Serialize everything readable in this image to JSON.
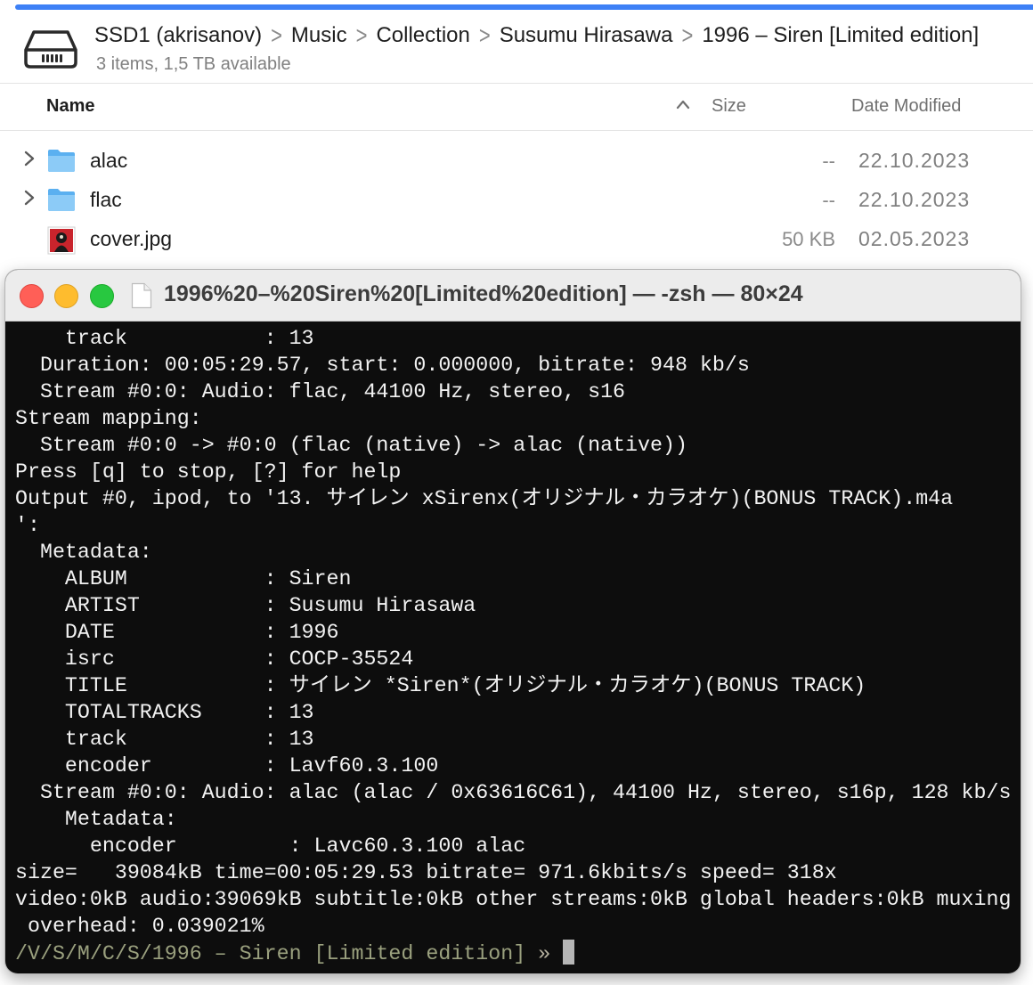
{
  "finder": {
    "accent_color": "#3d80f6",
    "drive_icon": "external-drive-icon",
    "breadcrumb": [
      "SSD1 (akrisanov)",
      "Music",
      "Collection",
      "Susumu Hirasawa",
      "1996 – Siren [Limited edition]"
    ],
    "breadcrumb_separator": ">",
    "subtitle": "3 items, 1,5 TB available",
    "columns": {
      "name": "Name",
      "sort_caret": "^",
      "size": "Size",
      "date": "Date Modified"
    },
    "rows": [
      {
        "disclosure": ">",
        "icon": "folder-icon",
        "name": "alac",
        "size": "--",
        "date": "22.10.2023"
      },
      {
        "disclosure": ">",
        "icon": "folder-icon",
        "name": "flac",
        "size": "--",
        "date": "22.10.2023"
      },
      {
        "disclosure": "",
        "icon": "image-thumbnail-icon",
        "name": "cover.jpg",
        "size": "50 KB",
        "date": "02.05.2023"
      }
    ]
  },
  "terminal": {
    "title": "1996%20–%20Siren%20[Limited%20edition] — -zsh — 80×24",
    "lines": [
      "    track           : 13",
      "  Duration: 00:05:29.57, start: 0.000000, bitrate: 948 kb/s",
      "  Stream #0:0: Audio: flac, 44100 Hz, stereo, s16",
      "Stream mapping:",
      "  Stream #0:0 -> #0:0 (flac (native) -> alac (native))",
      "Press [q] to stop, [?] for help",
      "Output #0, ipod, to '13. サイレン xSirenx(オリジナル・カラオケ)(BONUS TRACK).m4a",
      "':",
      "  Metadata:",
      "    ALBUM           : Siren",
      "    ARTIST          : Susumu Hirasawa",
      "    DATE            : 1996",
      "    isrc            : COCP-35524",
      "    TITLE           : サイレン *Siren*(オリジナル・カラオケ)(BONUS TRACK)",
      "    TOTALTRACKS     : 13",
      "    track           : 13",
      "    encoder         : Lavf60.3.100",
      "  Stream #0:0: Audio: alac (alac / 0x63616C61), 44100 Hz, stereo, s16p, 128 kb/s",
      "    Metadata:",
      "      encoder         : Lavc60.3.100 alac",
      "size=   39084kB time=00:05:29.53 bitrate= 971.6kbits/s speed= 318x",
      "video:0kB audio:39069kB subtitle:0kB other streams:0kB global headers:0kB muxing",
      " overhead: 0.039021%"
    ],
    "prompt_path": "/V/S/M/C/S/1996 – Siren [Limited edition]",
    "prompt_symbol": "»"
  }
}
